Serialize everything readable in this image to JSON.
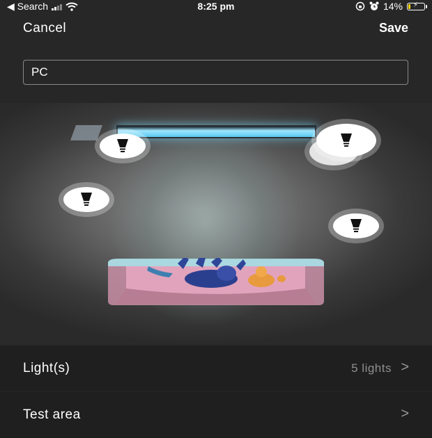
{
  "status_bar": {
    "back_label": "◀ Search",
    "time": "8:25 pm",
    "battery_percent": "14%",
    "battery_level": 0.14
  },
  "header": {
    "cancel_label": "Cancel",
    "save_label": "Save"
  },
  "name_field": {
    "value": "PC"
  },
  "scene": {
    "light_count": 5,
    "icons": [
      "bulb-icon",
      "tv-icon",
      "sofa-icon",
      "dog-icon",
      "cat-icon"
    ]
  },
  "rows": [
    {
      "label": "Light(s)",
      "value": "5 lights",
      "chevron": ">"
    },
    {
      "label": "Test area",
      "value": "",
      "chevron": ">"
    }
  ],
  "colors": {
    "background": "#272727",
    "row_background": "#1f1f1f",
    "tv_glow": "#58c8f0",
    "battery_fill": "#ffd60a",
    "secondary_text": "#8f8f8f"
  }
}
